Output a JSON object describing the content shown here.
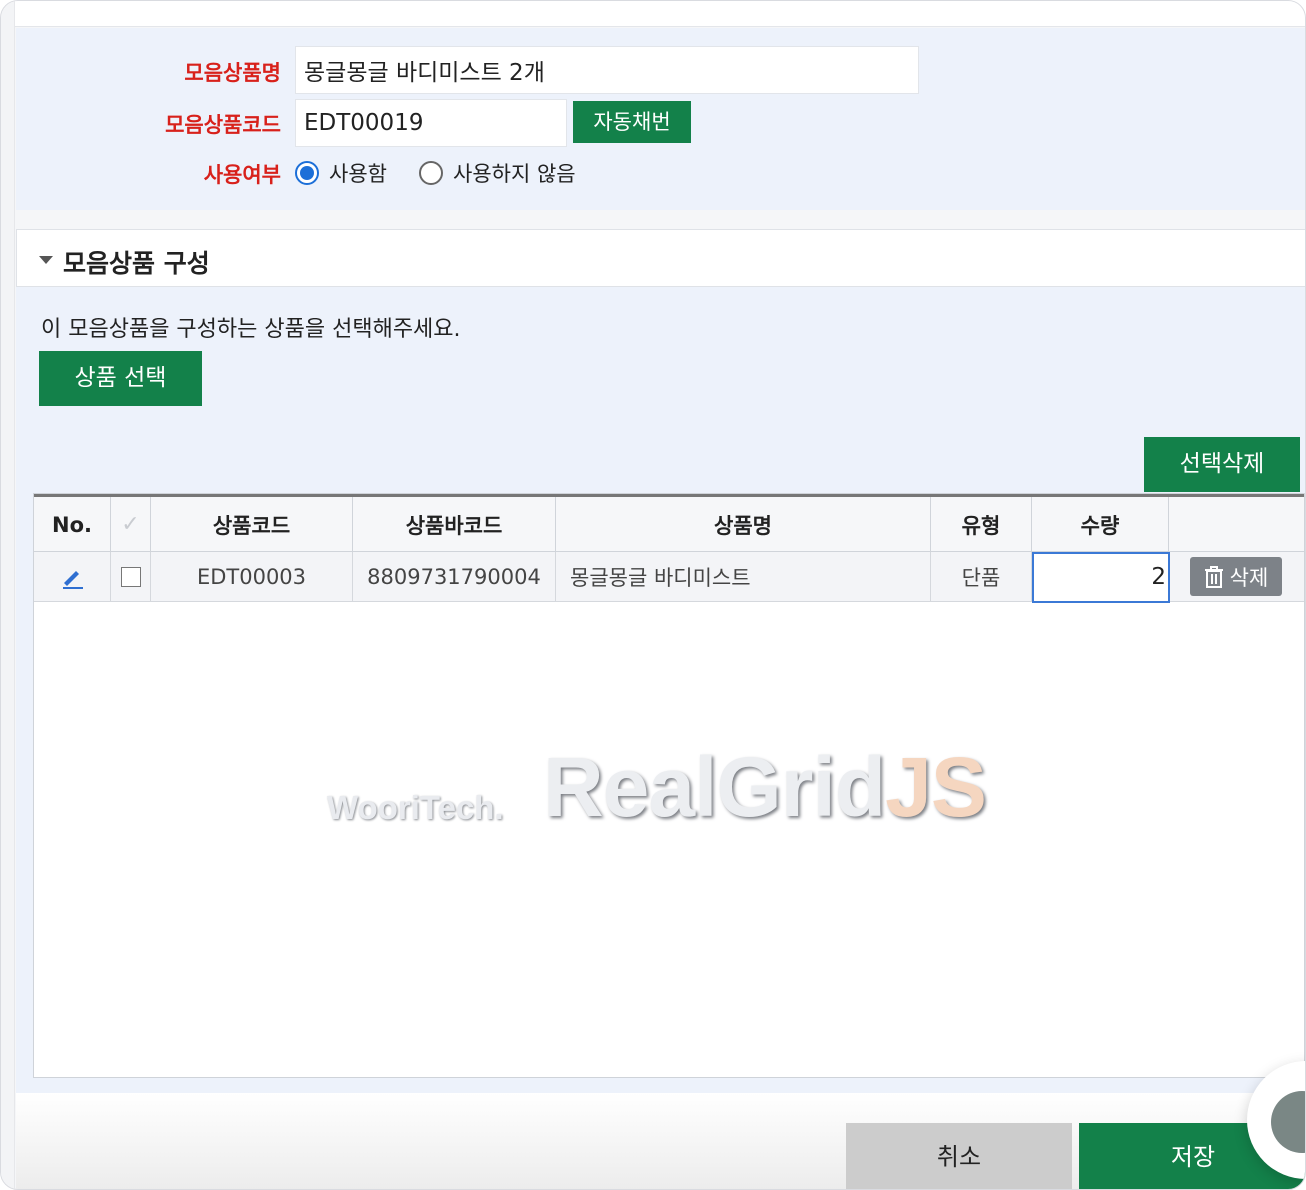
{
  "form": {
    "name_label": "모음상품명",
    "name_value": "몽글몽글 바디미스트 2개",
    "code_label": "모음상품코드",
    "code_value": "EDT00019",
    "auto_number_label": "자동채번",
    "use_label": "사용여부",
    "use_options": [
      "사용함",
      "사용하지 않음"
    ],
    "use_selected": "사용함"
  },
  "section": {
    "title": "모음상품 구성",
    "hint": "이 모음상품을 구성하는 상품을 선택해주세요.",
    "select_button": "상품 선택",
    "delete_selected_button": "선택삭제"
  },
  "grid": {
    "columns": [
      "No.",
      "",
      "상품코드",
      "상품바코드",
      "상품명",
      "유형",
      "수량",
      ""
    ],
    "rows": [
      {
        "no_icon": "edit-pencil-icon",
        "code": "EDT00003",
        "barcode": "8809731790004",
        "name": "몽글몽글 바디미스트",
        "type": "단품",
        "qty": "2",
        "delete_label": "삭제"
      }
    ],
    "watermark_small": "WooriTech.",
    "watermark_big_main": "RealGrid",
    "watermark_big_suffix": "JS"
  },
  "footer": {
    "cancel": "취소",
    "save": "저장"
  },
  "colors": {
    "accent_green": "#13814a",
    "label_red": "#d8211b",
    "panel_blue": "#edf2fb"
  }
}
